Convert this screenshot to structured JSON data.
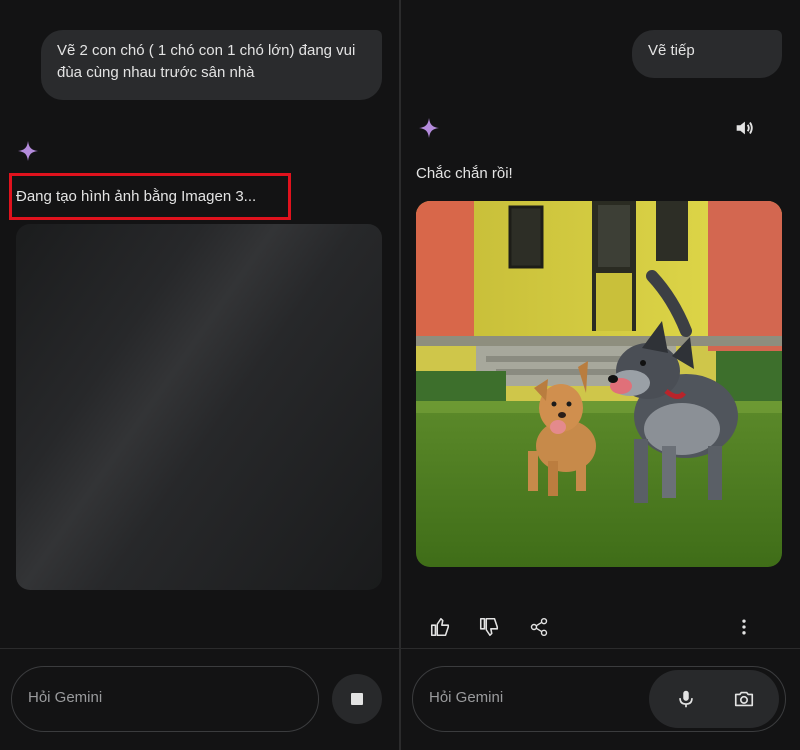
{
  "left": {
    "user_message": "Vẽ 2 con chó ( 1 chó con 1 chó lớn) đang vui đùa cùng nhau trước sân nhà",
    "status_text": "Đang tạo hình ảnh bằng Imagen 3...",
    "input_placeholder": "Hỏi Gemini",
    "stop_icon": "stop-square-icon"
  },
  "right": {
    "user_message": "Vẽ tiếp",
    "response_text": "Chắc chắn rồi!",
    "input_placeholder": "Hỏi Gemini",
    "icons": [
      "gemini-spark-icon",
      "speaker-icon",
      "thumbs-up-icon",
      "thumbs-down-icon",
      "share-icon",
      "more-vert-icon",
      "mic-icon",
      "camera-icon"
    ]
  },
  "colors": {
    "background": "#131314",
    "bubble": "#2a2b2d",
    "highlight": "#e0121d",
    "spark": "#b48bdc"
  }
}
